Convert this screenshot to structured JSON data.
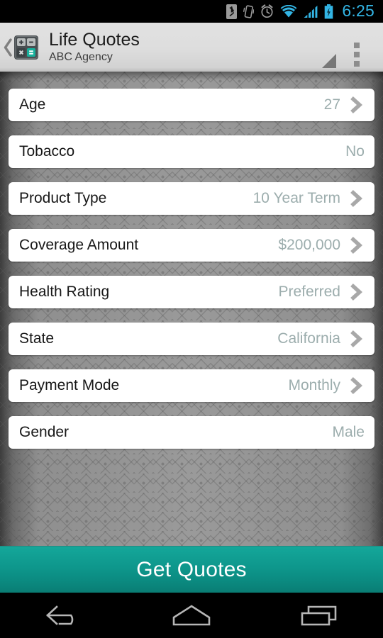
{
  "status_bar": {
    "time": "6:25",
    "accent_color": "#33b5e5",
    "icons": [
      {
        "name": "bluetooth-icon",
        "label": "Bluetooth"
      },
      {
        "name": "vibrate-icon",
        "label": "Vibrate"
      },
      {
        "name": "alarm-icon",
        "label": "Alarm"
      },
      {
        "name": "wifi-icon",
        "label": "Wi-Fi"
      },
      {
        "name": "cellular-signal-icon",
        "label": "Signal"
      },
      {
        "name": "battery-charging-icon",
        "label": "Battery charging"
      }
    ]
  },
  "action_bar": {
    "back_label": "‹",
    "app_icon": "calculator-icon",
    "title": "Life Quotes",
    "subtitle": "ABC Agency",
    "spinner_indicator": "dropdown-triangle-icon",
    "overflow_label": "overflow-menu-icon",
    "background_color": "#dddddd"
  },
  "form": {
    "rows": [
      {
        "label": "Age",
        "value": "27",
        "chevron": true
      },
      {
        "label": "Tobacco",
        "value": "No",
        "chevron": false
      },
      {
        "label": "Product Type",
        "value": "10 Year Term",
        "chevron": true
      },
      {
        "label": "Coverage Amount",
        "value": "$200,000",
        "chevron": true
      },
      {
        "label": "Health Rating",
        "value": "Preferred",
        "chevron": true
      },
      {
        "label": "State",
        "value": "California",
        "chevron": true
      },
      {
        "label": "Payment Mode",
        "value": "Monthly",
        "chevron": true
      },
      {
        "label": "Gender",
        "value": "Male",
        "chevron": false
      }
    ],
    "label_color": "#171717",
    "value_color": "#9cadad",
    "card_color": "#ffffff"
  },
  "cta": {
    "label": "Get Quotes",
    "color": "#0e978c",
    "text_color": "#ffffff"
  },
  "nav_bar": {
    "buttons": [
      {
        "name": "nav-back-button",
        "label": "Back"
      },
      {
        "name": "nav-home-button",
        "label": "Home"
      },
      {
        "name": "nav-recents-button",
        "label": "Recents"
      }
    ]
  }
}
